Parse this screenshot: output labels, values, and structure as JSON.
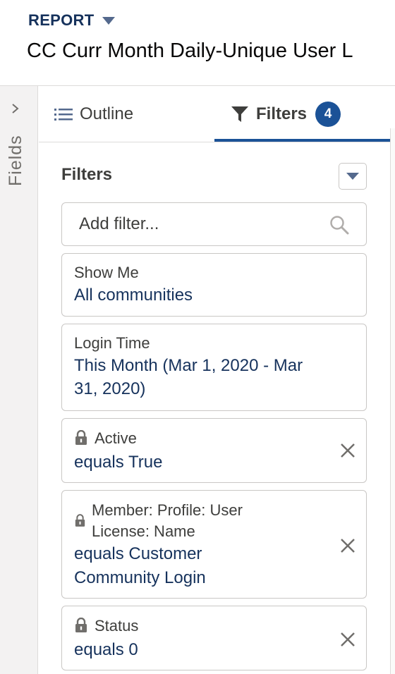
{
  "header": {
    "type_label": "REPORT",
    "title": "CC Curr Month Daily-Unique User L"
  },
  "side_rail": {
    "fields_label": "Fields"
  },
  "tabs": {
    "outline_label": "Outline",
    "filters_label": "Filters",
    "filters_count": "4"
  },
  "panel": {
    "title": "Filters",
    "search_placeholder": "Add filter..."
  },
  "filters": [
    {
      "label": "Show Me",
      "value": "All communities",
      "locked": false,
      "removable": false
    },
    {
      "label": "Login Time",
      "value_line1": "This Month (Mar 1, 2020 - Mar",
      "value_line2": "31, 2020)",
      "locked": false,
      "removable": false
    },
    {
      "label": "Active",
      "value": "equals True",
      "locked": true,
      "removable": true
    },
    {
      "label_line1": "Member: Profile: User",
      "label_line2": "License: Name",
      "value_line1": "equals Customer",
      "value_line2": "Community Login",
      "locked": true,
      "removable": true
    },
    {
      "label": "Status",
      "value": "equals 0",
      "locked": true,
      "removable": true
    }
  ],
  "colors": {
    "accent": "#1b5297",
    "link_text": "#16325c",
    "border": "#c9c7c5"
  }
}
